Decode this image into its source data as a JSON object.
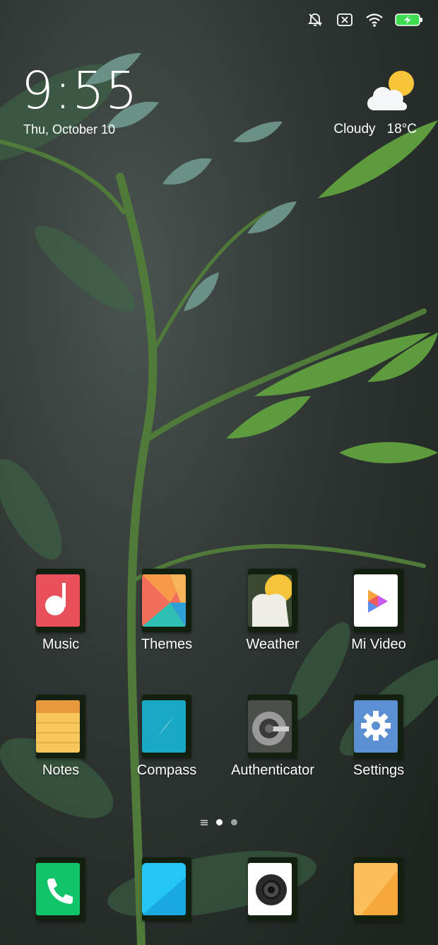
{
  "status_bar": {
    "icons": [
      "alarm-off-icon",
      "no-sim-icon",
      "wifi-icon",
      "battery-charging-icon"
    ],
    "battery_color": "#3ddc50"
  },
  "clock": {
    "time": "9:55",
    "date": "Thu, October 10"
  },
  "weather": {
    "icon": "partly-cloudy-icon",
    "condition": "Cloudy",
    "temperature": "18°C"
  },
  "apps": [
    {
      "label": "Music",
      "icon": "music-note-icon",
      "color": "#e8505b"
    },
    {
      "label": "Themes",
      "icon": "themes-icon",
      "color": "#f35a4a"
    },
    {
      "label": "Weather",
      "icon": "weather-sun-cloud-icon",
      "color": "#f6c43a"
    },
    {
      "label": "Mi Video",
      "icon": "play-icon",
      "color": "#ffffff"
    },
    {
      "label": "Notes",
      "icon": "notes-icon",
      "color": "#f7c65b"
    },
    {
      "label": "Compass",
      "icon": "compass-icon",
      "color": "#1aa9c4"
    },
    {
      "label": "Authenticator",
      "icon": "authenticator-icon",
      "color": "#9a9a9a"
    },
    {
      "label": "Settings",
      "icon": "gear-icon",
      "color": "#5b8fd1"
    }
  ],
  "page_indicator": {
    "pages": 2,
    "active": 1
  },
  "dock": [
    {
      "icon": "phone-icon",
      "color": "#10c469"
    },
    {
      "icon": "messaging-icon",
      "color": "#23c6f5"
    },
    {
      "icon": "camera-icon",
      "color": "#ffffff"
    },
    {
      "icon": "browser-icon",
      "color": "#fbbe5a"
    }
  ]
}
